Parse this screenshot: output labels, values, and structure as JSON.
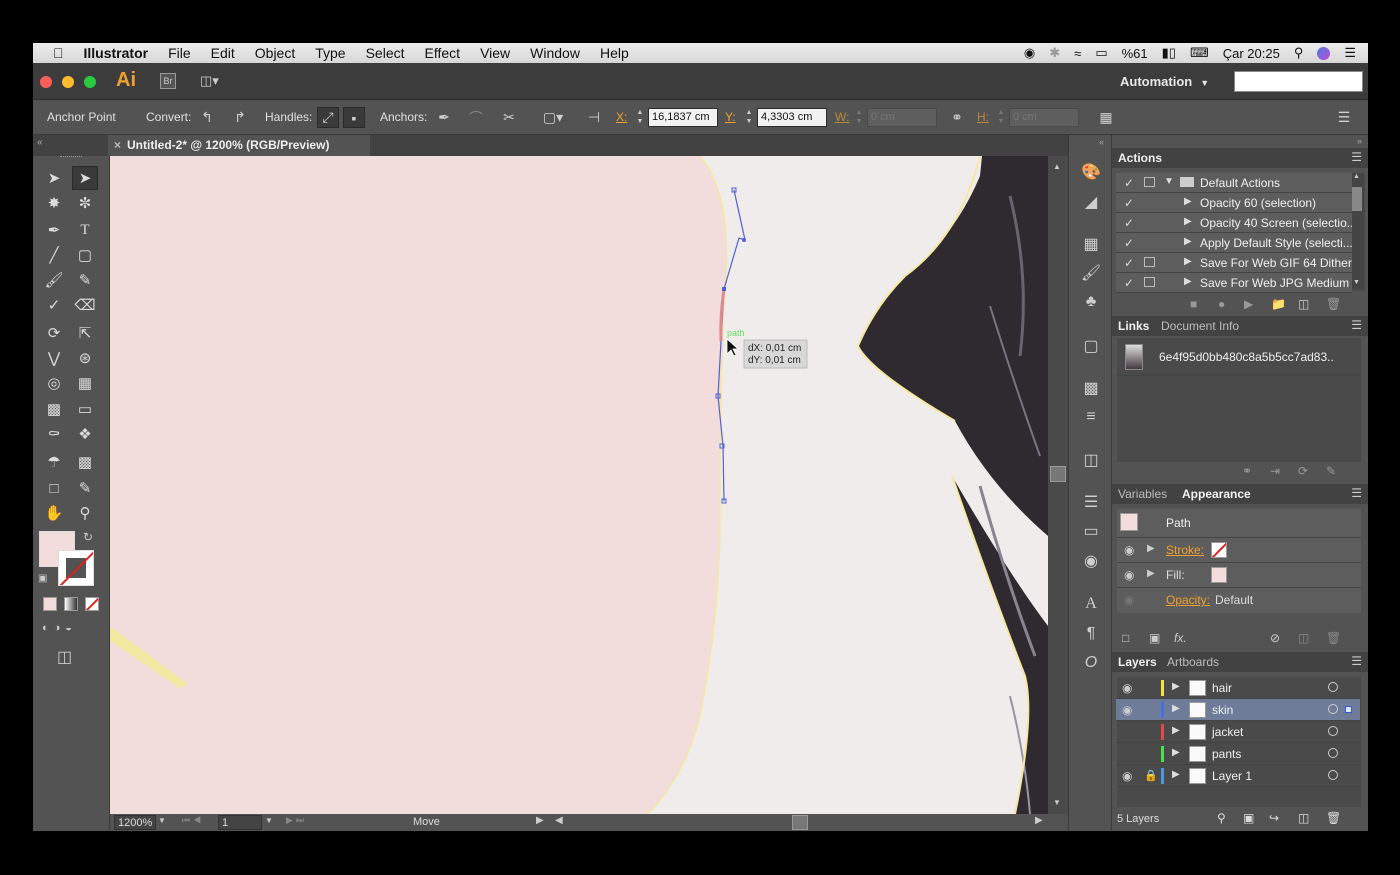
{
  "menubar": {
    "apple_icon": "apple-icon",
    "app_name": "Illustrator",
    "items": [
      "File",
      "Edit",
      "Object",
      "Type",
      "Select",
      "Effect",
      "View",
      "Window",
      "Help"
    ],
    "battery": "%61",
    "clock": "Çar 20:25"
  },
  "appbar": {
    "logo": "Ai",
    "bridge_label": "Br",
    "workspace": "Automation",
    "search_value": ""
  },
  "controlbar": {
    "tool_name": "Anchor Point",
    "convert_label": "Convert:",
    "handles_label": "Handles:",
    "anchors_label": "Anchors:",
    "x_label": "X:",
    "x_value": "16,1837 cm",
    "y_label": "Y:",
    "y_value": "4,3303 cm",
    "w_label": "W:",
    "w_value": "0 cm",
    "h_label": "H:",
    "h_value": "0 cm"
  },
  "document": {
    "tab_title": "Untitled-2* @ 1200% (RGB/Preview)",
    "tab_close": "×"
  },
  "canvas": {
    "smart_guide_label": "path",
    "tooltip_dx": "dX: 0,01 cm",
    "tooltip_dy": "dY: 0,01 cm"
  },
  "statusbar": {
    "zoom": "1200%",
    "artboard": "1",
    "status": "Move"
  },
  "actions_panel": {
    "title": "Actions",
    "items": [
      {
        "label": "Default Actions",
        "kind": "folder"
      },
      {
        "label": "Opacity 60 (selection)",
        "kind": "action"
      },
      {
        "label": "Opacity 40 Screen (selectio...",
        "kind": "action"
      },
      {
        "label": "Apply Default Style (selecti...",
        "kind": "action"
      },
      {
        "label": "Save For Web GIF 64 Dither...",
        "kind": "action"
      },
      {
        "label": "Save For Web JPG Medium",
        "kind": "action"
      }
    ]
  },
  "links_panel": {
    "tab_links": "Links",
    "tab_docinfo": "Document Info",
    "link_name": "6e4f95d0bb480c8a5b5cc7ad83.."
  },
  "appearance_panel": {
    "tab_variables": "Variables",
    "tab_appearance": "Appearance",
    "object": "Path",
    "stroke_label": "Stroke:",
    "fill_label": "Fill:",
    "opacity_label": "Opacity:",
    "opacity_value": "Default",
    "fx_label": "fx."
  },
  "layers_panel": {
    "tab_layers": "Layers",
    "tab_artboards": "Artboards",
    "layers": [
      {
        "name": "hair",
        "color": "#f2e44a",
        "visible": true,
        "locked": false,
        "selected": false
      },
      {
        "name": "skin",
        "color": "#4a6ee0",
        "visible": true,
        "locked": false,
        "selected": true
      },
      {
        "name": "jacket",
        "color": "#e04a4a",
        "visible": false,
        "locked": false,
        "selected": false
      },
      {
        "name": "pants",
        "color": "#4ae04a",
        "visible": false,
        "locked": false,
        "selected": false
      },
      {
        "name": "Layer 1",
        "color": "#4a9ae0",
        "visible": true,
        "locked": true,
        "selected": false
      }
    ],
    "count": "5 Layers"
  },
  "colors": {
    "skin_fill": "#f2dcdc",
    "canvas_bg": "#f0ecec",
    "hair": "#2e2a30",
    "path_blue": "#5060d8",
    "guide_green": "#5ee05e",
    "outline_yellow": "#f3e9a0",
    "ai_orange": "#f0a030"
  }
}
